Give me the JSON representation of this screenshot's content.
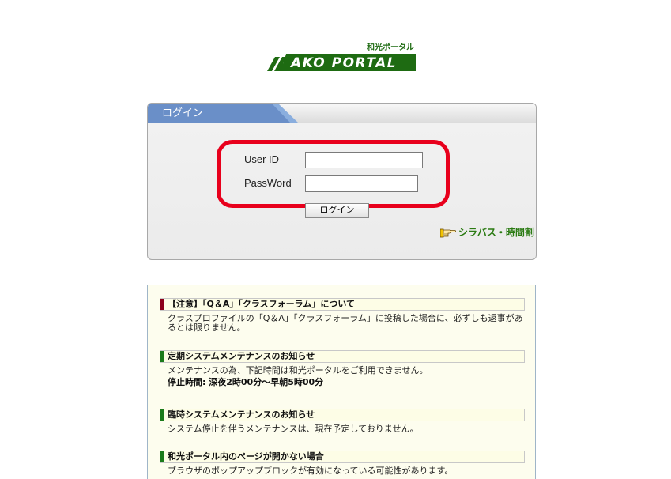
{
  "logo": {
    "japanese": "和光ポータル",
    "text": "AKO PORTAL",
    "colors": {
      "bar": "#1e6b12",
      "text": "#ffffff"
    }
  },
  "login": {
    "title": "ログイン",
    "userid_label": "User ID",
    "userid_value": "",
    "password_label": "PassWord",
    "password_value": "",
    "button_label": "ログイン",
    "syllabus_link": "シラバス・時間割",
    "highlight_color": "#e8001c"
  },
  "notices": [
    {
      "title": "【注意】「Q＆A」「クラスフォーラム」について",
      "marker": "red",
      "body": [
        "クラスプロファイルの「Q＆A」「クラスフォーラム」に投稿した場合に、必ずしも返事があるとは限りません。"
      ]
    },
    {
      "title": "定期システムメンテナンスのお知らせ",
      "marker": "green",
      "body": [
        "メンテナンスの為、下記時間は和光ポータルをご利用できません。"
      ],
      "bold": "停止時間: 深夜2時00分～早朝5時00分"
    },
    {
      "title": "臨時システムメンテナンスのお知らせ",
      "marker": "green",
      "body": [
        "システム停止を伴うメンテナンスは、現在予定しておりません。"
      ]
    },
    {
      "title": "和光ポータル内のページが開かない場合",
      "marker": "green",
      "body": [
        "ブラウザのポップアップブロックが有効になっている可能性があります。"
      ]
    }
  ]
}
